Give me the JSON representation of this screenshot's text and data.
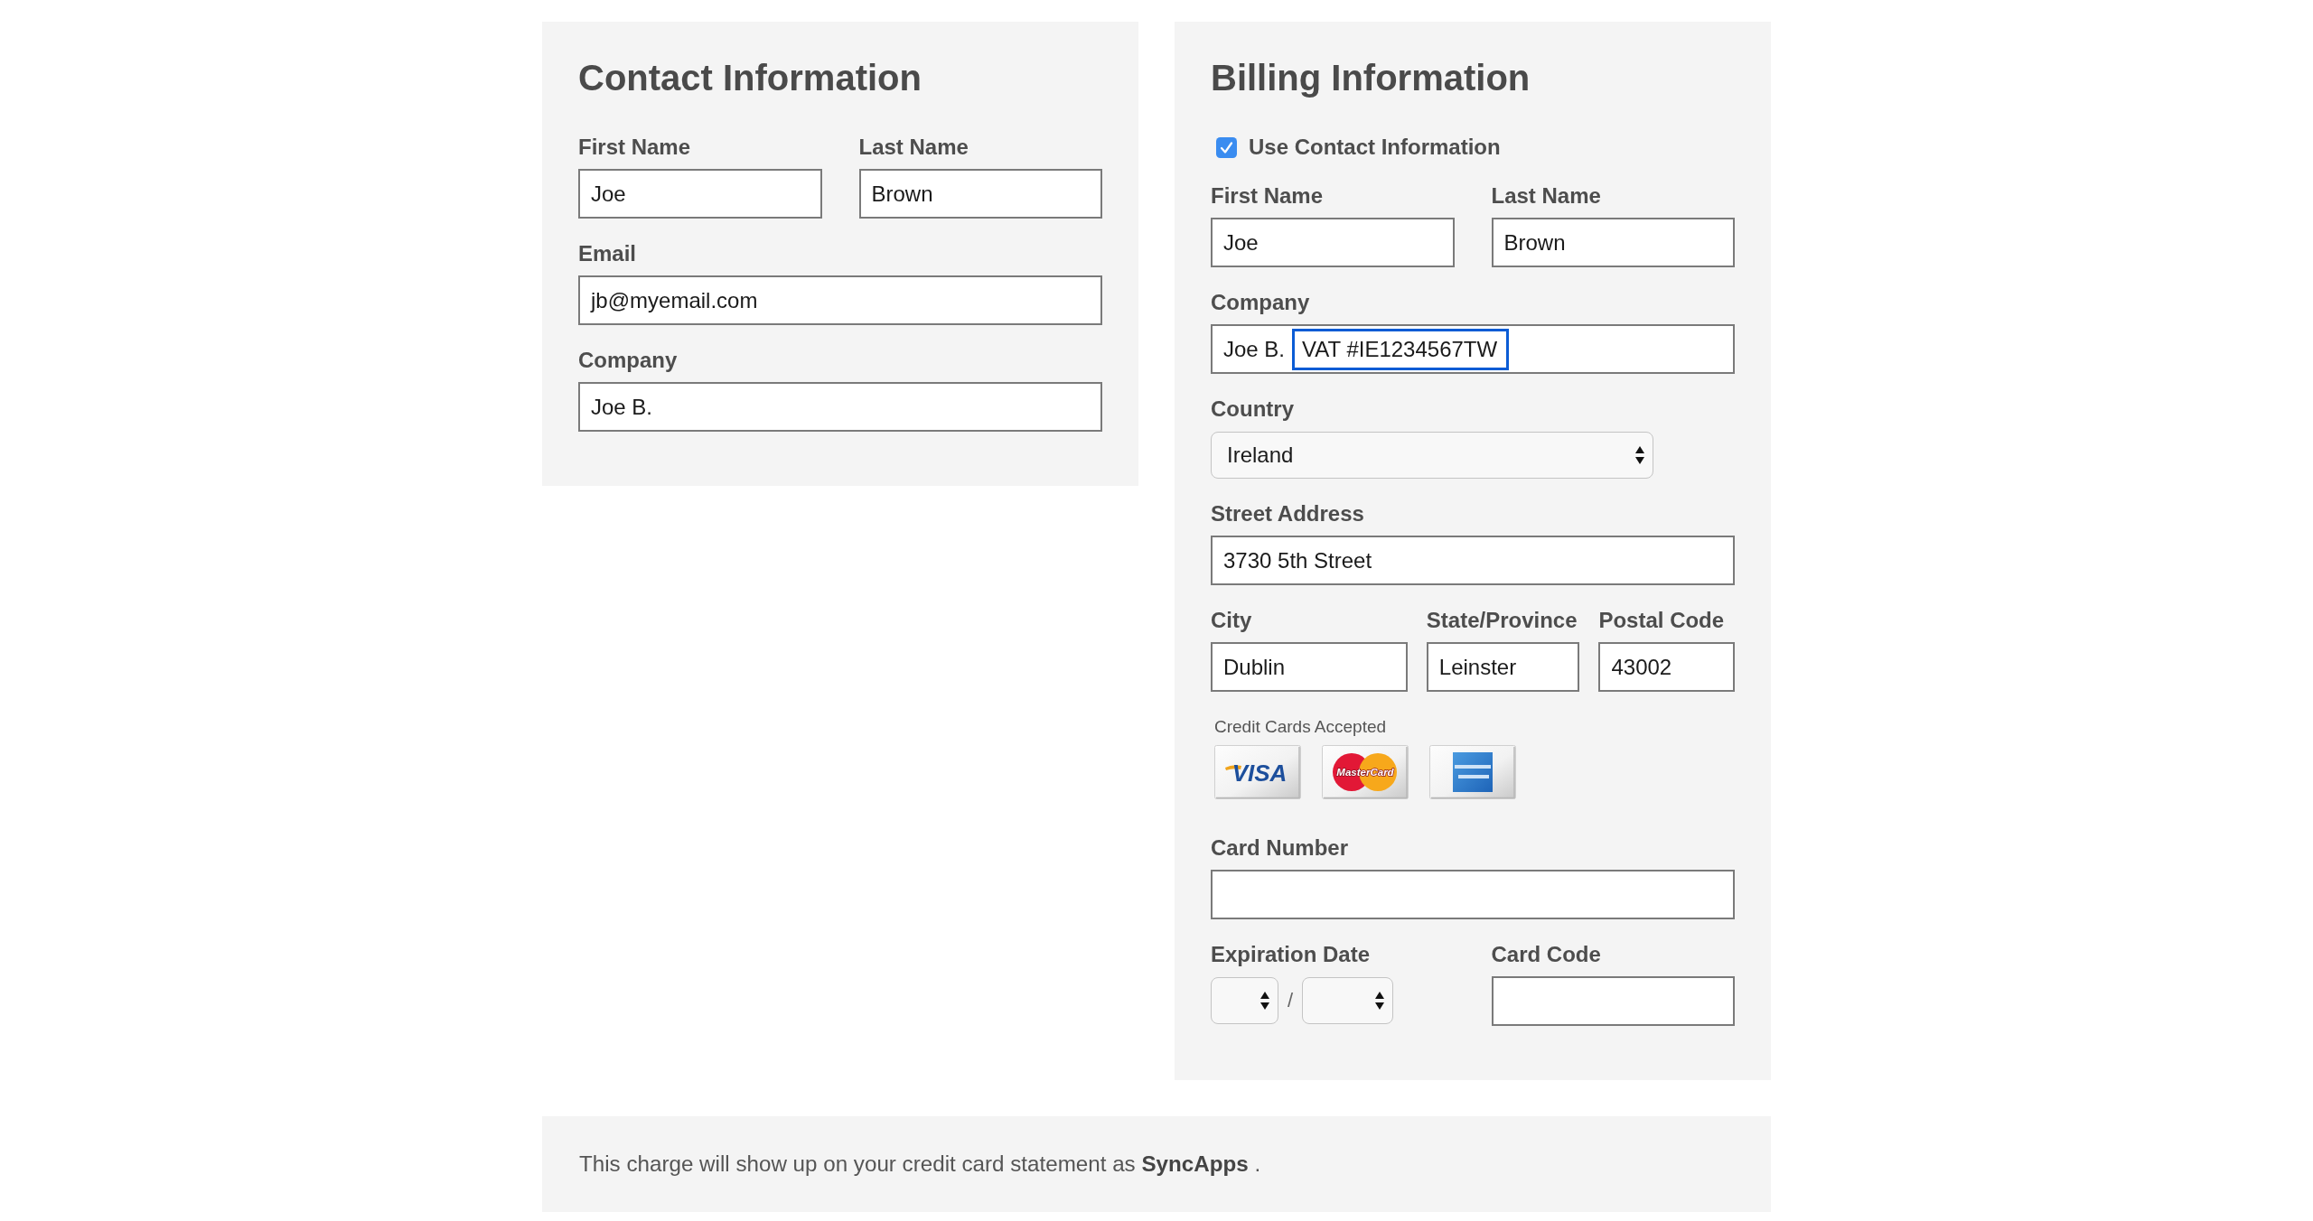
{
  "contact_panel": {
    "title": "Contact Information",
    "rows": [
      {
        "kind": "fields",
        "fields": [
          {
            "kind": "text",
            "label": "First Name",
            "value": "Joe"
          },
          {
            "kind": "text",
            "label": "Last Name",
            "value": "Brown"
          }
        ]
      },
      {
        "kind": "fields",
        "fields": [
          {
            "kind": "text",
            "label": "Email",
            "value": "jb@myemail.com"
          }
        ]
      },
      {
        "kind": "fields",
        "fields": [
          {
            "kind": "text",
            "label": "Company",
            "value": "Joe B."
          }
        ]
      }
    ]
  },
  "billing_panel": {
    "title": "Billing Information",
    "rows": [
      {
        "kind": "checkbox",
        "label": "Use Contact Information",
        "checked": true
      },
      {
        "kind": "fields",
        "fields": [
          {
            "kind": "text",
            "label": "First Name",
            "value": "Joe"
          },
          {
            "kind": "text",
            "label": "Last Name",
            "value": "Brown"
          }
        ]
      },
      {
        "kind": "fields",
        "fields": [
          {
            "kind": "text",
            "label": "Company",
            "value": "Joe B.",
            "highlight": "VAT #IE1234567TW"
          }
        ]
      },
      {
        "kind": "fields",
        "fields": [
          {
            "kind": "select",
            "label": "Country",
            "value": "Ireland"
          }
        ]
      },
      {
        "kind": "fields",
        "fields": [
          {
            "kind": "text",
            "label": "Street Address",
            "value": "3730 5th Street"
          }
        ]
      },
      {
        "kind": "fields",
        "fields": [
          {
            "kind": "text",
            "label": "City",
            "value": "Dublin"
          },
          {
            "kind": "text",
            "label": "State/Province",
            "value": "Leinster"
          },
          {
            "kind": "text",
            "label": "Postal Code",
            "value": "43002"
          }
        ]
      },
      {
        "kind": "cards",
        "label": "Credit Cards Accepted",
        "cards": [
          {
            "kind": "visa",
            "logo_text": "VISA"
          },
          {
            "kind": "mastercard",
            "logo_text": "MasterCard"
          },
          {
            "kind": "amex"
          }
        ]
      },
      {
        "kind": "fields",
        "fields": [
          {
            "kind": "text",
            "label": "Card Number"
          }
        ]
      },
      {
        "kind": "fields",
        "fields": [
          {
            "kind": "expiry",
            "label": "Expiration Date",
            "separator": "/"
          },
          {
            "kind": "text",
            "label": "Card Code"
          }
        ]
      }
    ]
  },
  "footer": {
    "text": "This charge will show up on your credit card statement as **SyncApps** ."
  }
}
